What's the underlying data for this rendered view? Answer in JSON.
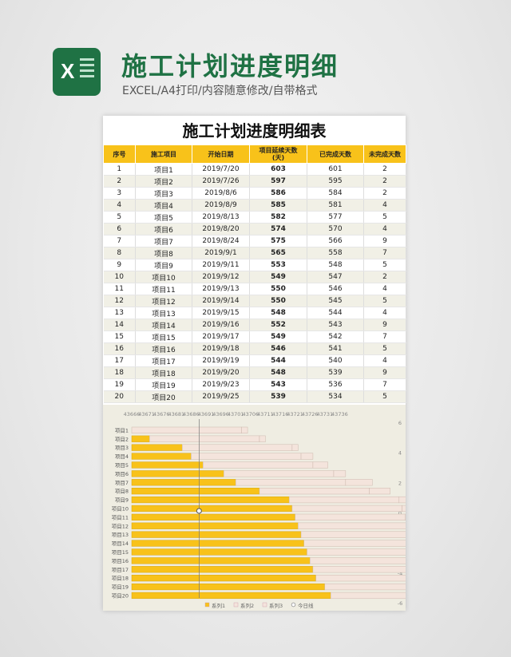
{
  "header": {
    "title": "施工计划进度明细",
    "subtitle": "EXCEL/A4打印/内容随意修改/自带格式"
  },
  "colors": {
    "accent": "#f8c21a",
    "brand": "#1f7244",
    "series2": "#f4e4dc"
  },
  "sheet": {
    "title": "施工计划进度明细表",
    "columns": [
      "序号",
      "施工项目",
      "开始日期",
      "项目延续天数\n(天)",
      "已完成天数",
      "未完成天数"
    ],
    "rows": [
      [
        "1",
        "项目1",
        "2019/7/20",
        "603",
        "601",
        "2"
      ],
      [
        "2",
        "项目2",
        "2019/7/26",
        "597",
        "595",
        "2"
      ],
      [
        "3",
        "项目3",
        "2019/8/6",
        "586",
        "584",
        "2"
      ],
      [
        "4",
        "项目4",
        "2019/8/9",
        "585",
        "581",
        "4"
      ],
      [
        "5",
        "项目5",
        "2019/8/13",
        "582",
        "577",
        "5"
      ],
      [
        "6",
        "项目6",
        "2019/8/20",
        "574",
        "570",
        "4"
      ],
      [
        "7",
        "项目7",
        "2019/8/24",
        "575",
        "566",
        "9"
      ],
      [
        "8",
        "项目8",
        "2019/9/1",
        "565",
        "558",
        "7"
      ],
      [
        "9",
        "项目9",
        "2019/9/11",
        "553",
        "548",
        "5"
      ],
      [
        "10",
        "项目10",
        "2019/9/12",
        "549",
        "547",
        "2"
      ],
      [
        "11",
        "项目11",
        "2019/9/13",
        "550",
        "546",
        "4"
      ],
      [
        "12",
        "项目12",
        "2019/9/14",
        "550",
        "545",
        "5"
      ],
      [
        "13",
        "项目13",
        "2019/9/15",
        "548",
        "544",
        "4"
      ],
      [
        "14",
        "项目14",
        "2019/9/16",
        "552",
        "543",
        "9"
      ],
      [
        "15",
        "项目15",
        "2019/9/17",
        "549",
        "542",
        "7"
      ],
      [
        "16",
        "项目16",
        "2019/9/18",
        "546",
        "541",
        "5"
      ],
      [
        "17",
        "项目17",
        "2019/9/19",
        "544",
        "540",
        "4"
      ],
      [
        "18",
        "项目18",
        "2019/9/20",
        "548",
        "539",
        "9"
      ],
      [
        "19",
        "项目19",
        "2019/9/23",
        "543",
        "536",
        "7"
      ],
      [
        "20",
        "项目20",
        "2019/9/25",
        "539",
        "534",
        "5"
      ]
    ]
  },
  "chart_data": {
    "type": "bar",
    "categories": [
      "项目1",
      "项目2",
      "项目3",
      "项目4",
      "项目5",
      "项目6",
      "项目7",
      "项目8",
      "项目9",
      "项目10",
      "项目11",
      "项目12",
      "项目13",
      "项目14",
      "项目15",
      "项目16",
      "项目17",
      "项目18",
      "项目19",
      "项目20"
    ],
    "series": [
      {
        "name": "系列1",
        "color": "#f8c21a",
        "values": [
          0,
          6,
          17,
          20,
          24,
          31,
          35,
          43,
          53,
          54,
          55,
          56,
          57,
          58,
          59,
          60,
          61,
          62,
          65,
          67
        ]
      },
      {
        "name": "系列2",
        "color": "#f4e4dc",
        "values": [
          37,
          37,
          37,
          37,
          37,
          37,
          37,
          37,
          37,
          37,
          37,
          37,
          37,
          37,
          37,
          37,
          37,
          37,
          37,
          37
        ]
      },
      {
        "name": "系列3",
        "color": "#f4e4dc",
        "values": [
          2,
          2,
          2,
          4,
          5,
          4,
          9,
          7,
          5,
          2,
          4,
          5,
          4,
          9,
          7,
          5,
          4,
          9,
          7,
          5
        ]
      }
    ],
    "today_line": {
      "name": "今日线",
      "x": 43703
    },
    "x_ticks": [
      "43666",
      "43671",
      "43676",
      "43681",
      "43686",
      "43691",
      "43696",
      "43701",
      "43706",
      "43711",
      "43716",
      "43721",
      "43726",
      "43731",
      "43736"
    ],
    "y2_ticks": [
      "6",
      "4",
      "2",
      "0",
      "-2",
      "-4",
      "-6"
    ],
    "xlim": [
      43666,
      43738
    ],
    "legend": "bottom"
  }
}
